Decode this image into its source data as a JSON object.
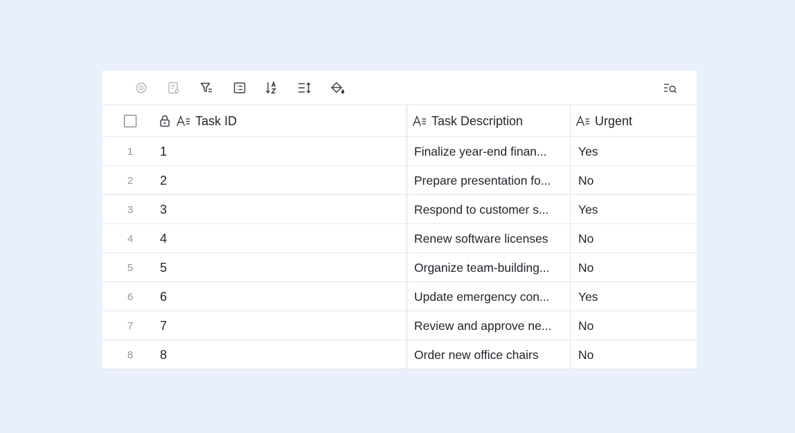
{
  "toolbar": {
    "icons": [
      "settings-icon",
      "form-view-icon",
      "filter-icon",
      "group-icon",
      "sort-icon",
      "row-height-icon",
      "fill-color-icon",
      "search-records-icon"
    ]
  },
  "table": {
    "columns": [
      {
        "key": "task_id",
        "label": "Task ID",
        "icon": "text-field-icon",
        "locked": true
      },
      {
        "key": "task_description",
        "label": "Task Description",
        "icon": "text-field-icon"
      },
      {
        "key": "urgent",
        "label": "Urgent",
        "icon": "text-field-icon"
      }
    ],
    "rows": [
      {
        "num": "1",
        "task_id": "1",
        "task_description": "Finalize year-end finan...",
        "urgent": "Yes"
      },
      {
        "num": "2",
        "task_id": "2",
        "task_description": "Prepare presentation fo...",
        "urgent": "No"
      },
      {
        "num": "3",
        "task_id": "3",
        "task_description": "Respond to customer s...",
        "urgent": "Yes"
      },
      {
        "num": "4",
        "task_id": "4",
        "task_description": "Renew software licenses",
        "urgent": "No"
      },
      {
        "num": "5",
        "task_id": "5",
        "task_description": "Organize team-building...",
        "urgent": "No"
      },
      {
        "num": "6",
        "task_id": "6",
        "task_description": "Update emergency con...",
        "urgent": "Yes"
      },
      {
        "num": "7",
        "task_id": "7",
        "task_description": "Review and approve ne...",
        "urgent": "No"
      },
      {
        "num": "8",
        "task_id": "8",
        "task_description": "Order new office chairs",
        "urgent": "No"
      }
    ]
  }
}
